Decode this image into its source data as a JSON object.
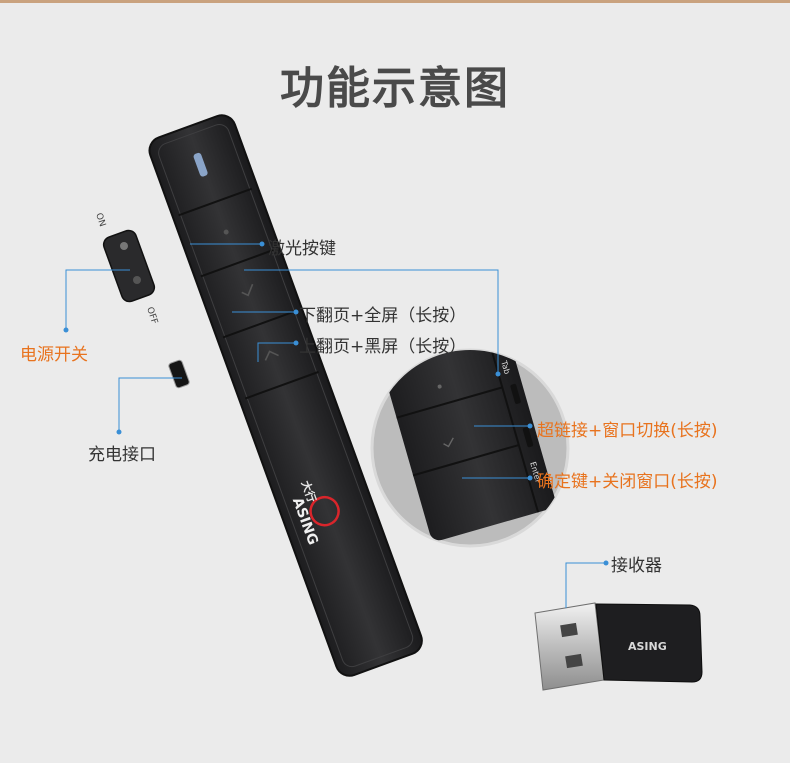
{
  "page": {
    "title": "功能示意图"
  },
  "device": {
    "logo_cn": "大行",
    "logo_en": "ASING",
    "switch_on": "ON",
    "switch_off": "OFF",
    "zoom_tab": "Tab",
    "zoom_enter": "Enter"
  },
  "receiver": {
    "logo": "ASING"
  },
  "labels": {
    "laser_key": "激光按键",
    "page_down": "下翻页+全屏（长按）",
    "page_up": "上翻页+黑屏（长按）",
    "power_switch": "电源开关",
    "charge_port": "充电接口",
    "hyperlink": "超链接+窗口切换(长按)",
    "confirm": "确定键+关闭窗口(长按)",
    "receiver": "接收器"
  },
  "colors": {
    "accent": "#e8731e",
    "leader_line": "#3a8fd6",
    "device_body": "#2b2b2d"
  }
}
